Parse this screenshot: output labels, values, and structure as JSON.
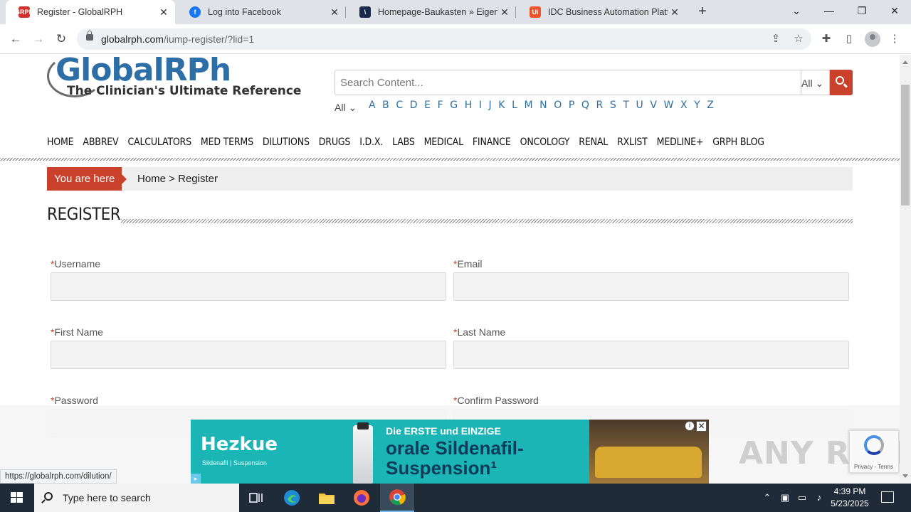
{
  "browser": {
    "tabs": [
      {
        "title": "Register - GlobalRPH",
        "favicon": "grph-favicon",
        "active": true
      },
      {
        "title": "Log into Facebook",
        "favicon": "facebook-favicon",
        "active": false
      },
      {
        "title": "Homepage-Baukasten » Eigene …",
        "favicon": "jimdo-favicon",
        "active": false
      },
      {
        "title": "IDC Business Automation Platfor…",
        "favicon": "uipath-favicon",
        "active": false
      }
    ],
    "url_domain": "globalrph.com",
    "url_path": "/iump-register/?lid=1",
    "status_url": "https://globalrph.com/dilution/"
  },
  "site": {
    "logo_text": "GlobalRPh",
    "logo_rx": "Rx",
    "logo_tagline": "The Clinician's Ultimate Reference",
    "search_placeholder": "Search Content...",
    "search_scope": "All",
    "alpha_all": "All",
    "alphabet": [
      "A",
      "B",
      "C",
      "D",
      "E",
      "F",
      "G",
      "H",
      "I",
      "J",
      "K",
      "L",
      "M",
      "N",
      "O",
      "P",
      "Q",
      "R",
      "S",
      "T",
      "U",
      "V",
      "W",
      "X",
      "Y",
      "Z"
    ],
    "nav": [
      "HOME",
      "ABBREV",
      "CALCULATORS",
      "MED TERMS",
      "DILUTIONS",
      "DRUGS",
      "I.D.X.",
      "LABS",
      "MEDICAL",
      "FINANCE",
      "ONCOLOGY",
      "RENAL",
      "RXLIST",
      "MEDLINE+",
      "GRPH BLOG"
    ]
  },
  "breadcrumb": {
    "you_are_here": "You are here",
    "trail": "Home > Register"
  },
  "form": {
    "title": "REGISTER",
    "required_marker": "*",
    "fields": [
      {
        "label": "Username",
        "value": ""
      },
      {
        "label": "Email",
        "value": ""
      },
      {
        "label": "First Name",
        "value": ""
      },
      {
        "label": "Last Name",
        "value": ""
      },
      {
        "label": "Password",
        "value": ""
      },
      {
        "label": "Confirm Password",
        "value": ""
      }
    ]
  },
  "ad": {
    "brand": "Hezkue",
    "brand_sub": "Sildenafil | Suspension",
    "line1": "Die ERSTE und EINZIGE",
    "line2": "orale Sildenafil-",
    "line3": "Suspension¹"
  },
  "recaptcha": {
    "links": "Privacy - Terms"
  },
  "watermark": "ANY RUN",
  "taskbar": {
    "search_placeholder": "Type here to search",
    "time": "4:39 PM",
    "date": "5/23/2025"
  },
  "colors": {
    "accent": "#c9412b",
    "brand_blue": "#2d6ea7",
    "taskbar": "#1f2b38"
  }
}
